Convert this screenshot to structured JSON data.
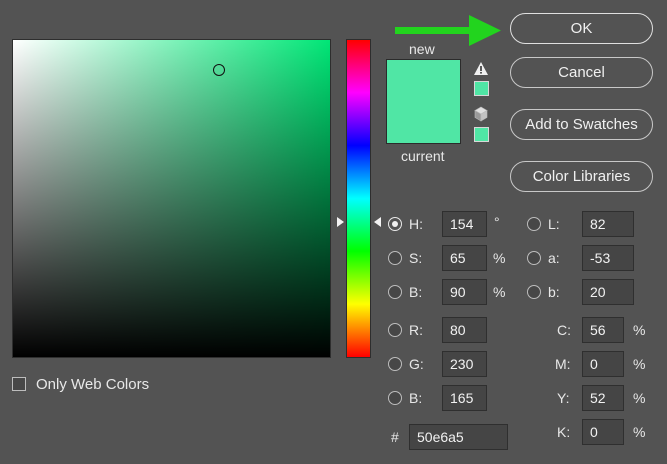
{
  "buttons": {
    "ok": "OK",
    "cancel": "Cancel",
    "add_to_swatches": "Add to Swatches",
    "color_libraries": "Color Libraries"
  },
  "preview": {
    "new_label": "new",
    "current_label": "current",
    "color": "#50e6a5"
  },
  "hsb": {
    "h_label": "H:",
    "h_value": "154",
    "h_unit": "°",
    "s_label": "S:",
    "s_value": "65",
    "s_unit": "%",
    "b_label": "B:",
    "b_value": "90",
    "b_unit": "%",
    "selected": "H"
  },
  "rgb": {
    "r_label": "R:",
    "r_value": "80",
    "g_label": "G:",
    "g_value": "230",
    "b_label": "B:",
    "b_value": "165"
  },
  "lab": {
    "l_label": "L:",
    "l_value": "82",
    "a_label": "a:",
    "a_value": "-53",
    "b_label": "b:",
    "b_value": "20"
  },
  "cmyk": {
    "c_label": "C:",
    "c_value": "56",
    "c_unit": "%",
    "m_label": "M:",
    "m_value": "0",
    "m_unit": "%",
    "y_label": "Y:",
    "y_value": "52",
    "y_unit": "%",
    "k_label": "K:",
    "k_value": "0",
    "k_unit": "%"
  },
  "hex": {
    "label": "#",
    "value": "50e6a5"
  },
  "only_web_colors": {
    "label": "Only Web Colors",
    "checked": false
  },
  "annotation": {
    "arrow_color": "#22d41e",
    "points_to": "OK"
  }
}
